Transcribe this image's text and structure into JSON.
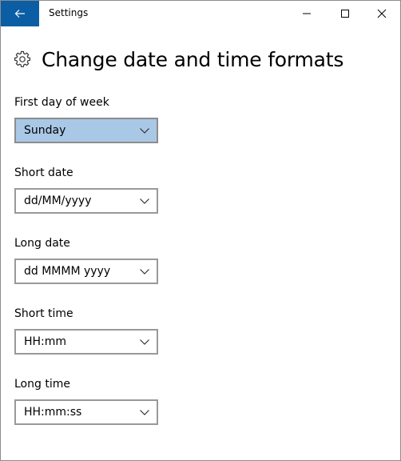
{
  "window": {
    "title": "Settings"
  },
  "page": {
    "heading": "Change date and time formats"
  },
  "settings": [
    {
      "label": "First day of week",
      "value": "Sunday"
    },
    {
      "label": "Short date",
      "value": "dd/MM/yyyy"
    },
    {
      "label": "Long date",
      "value": "dd MMMM yyyy"
    },
    {
      "label": "Short time",
      "value": "HH:mm"
    },
    {
      "label": "Long time",
      "value": "HH:mm:ss"
    }
  ],
  "colors": {
    "accent": "#0b5ea4",
    "selected_dropdown": "#a9c8e6",
    "border": "#999999"
  },
  "icons": {
    "back": "arrow-left-icon",
    "minimize": "minimize-icon",
    "maximize": "maximize-icon",
    "close": "close-icon",
    "page": "gear-icon",
    "dropdown": "chevron-down-icon"
  }
}
